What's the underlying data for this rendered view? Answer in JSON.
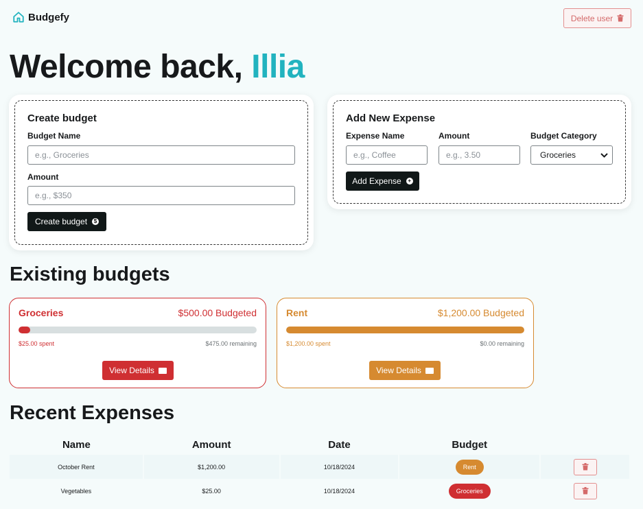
{
  "header": {
    "brand": "Budgefy",
    "delete_user_label": "Delete user"
  },
  "welcome": {
    "prefix": "Welcome back,",
    "user_name": "Illia"
  },
  "create_budget": {
    "title": "Create budget",
    "name_label": "Budget Name",
    "name_placeholder": "e.g., Groceries",
    "amount_label": "Amount",
    "amount_placeholder": "e.g., $350",
    "submit_label": "Create budget"
  },
  "add_expense": {
    "title": "Add New Expense",
    "name_label": "Expense Name",
    "name_placeholder": "e.g., Coffee",
    "amount_label": "Amount",
    "amount_placeholder": "e.g., 3.50",
    "category_label": "Budget Category",
    "category_selected": "Groceries",
    "submit_label": "Add Expense"
  },
  "existing_budgets": {
    "title": "Existing budgets",
    "items": [
      {
        "name": "Groceries",
        "budgeted": "$500.00 Budgeted",
        "spent": "$25.00 spent",
        "remaining": "$475.00 remaining",
        "progress": 0.05,
        "color": "#cf2f32",
        "button_label": "View Details"
      },
      {
        "name": "Rent",
        "budgeted": "$1,200.00 Budgeted",
        "spent": "$1,200.00 spent",
        "remaining": "$0.00 remaining",
        "progress": 1.0,
        "color": "#d68a30",
        "button_label": "View Details"
      }
    ]
  },
  "recent_expenses": {
    "title": "Recent Expenses",
    "columns": [
      "Name",
      "Amount",
      "Date",
      "Budget"
    ],
    "rows": [
      {
        "name": "October Rent",
        "amount": "$1,200.00",
        "date": "10/18/2024",
        "budget": "Rent",
        "budget_color": "#d68a30"
      },
      {
        "name": "Vegetables",
        "amount": "$25.00",
        "date": "10/18/2024",
        "budget": "Groceries",
        "budget_color": "#cf2f32"
      }
    ]
  },
  "colors": {
    "accent": "#22b3bf",
    "dark": "#111818",
    "danger": "#cf2f32",
    "warning": "#d68a30"
  }
}
